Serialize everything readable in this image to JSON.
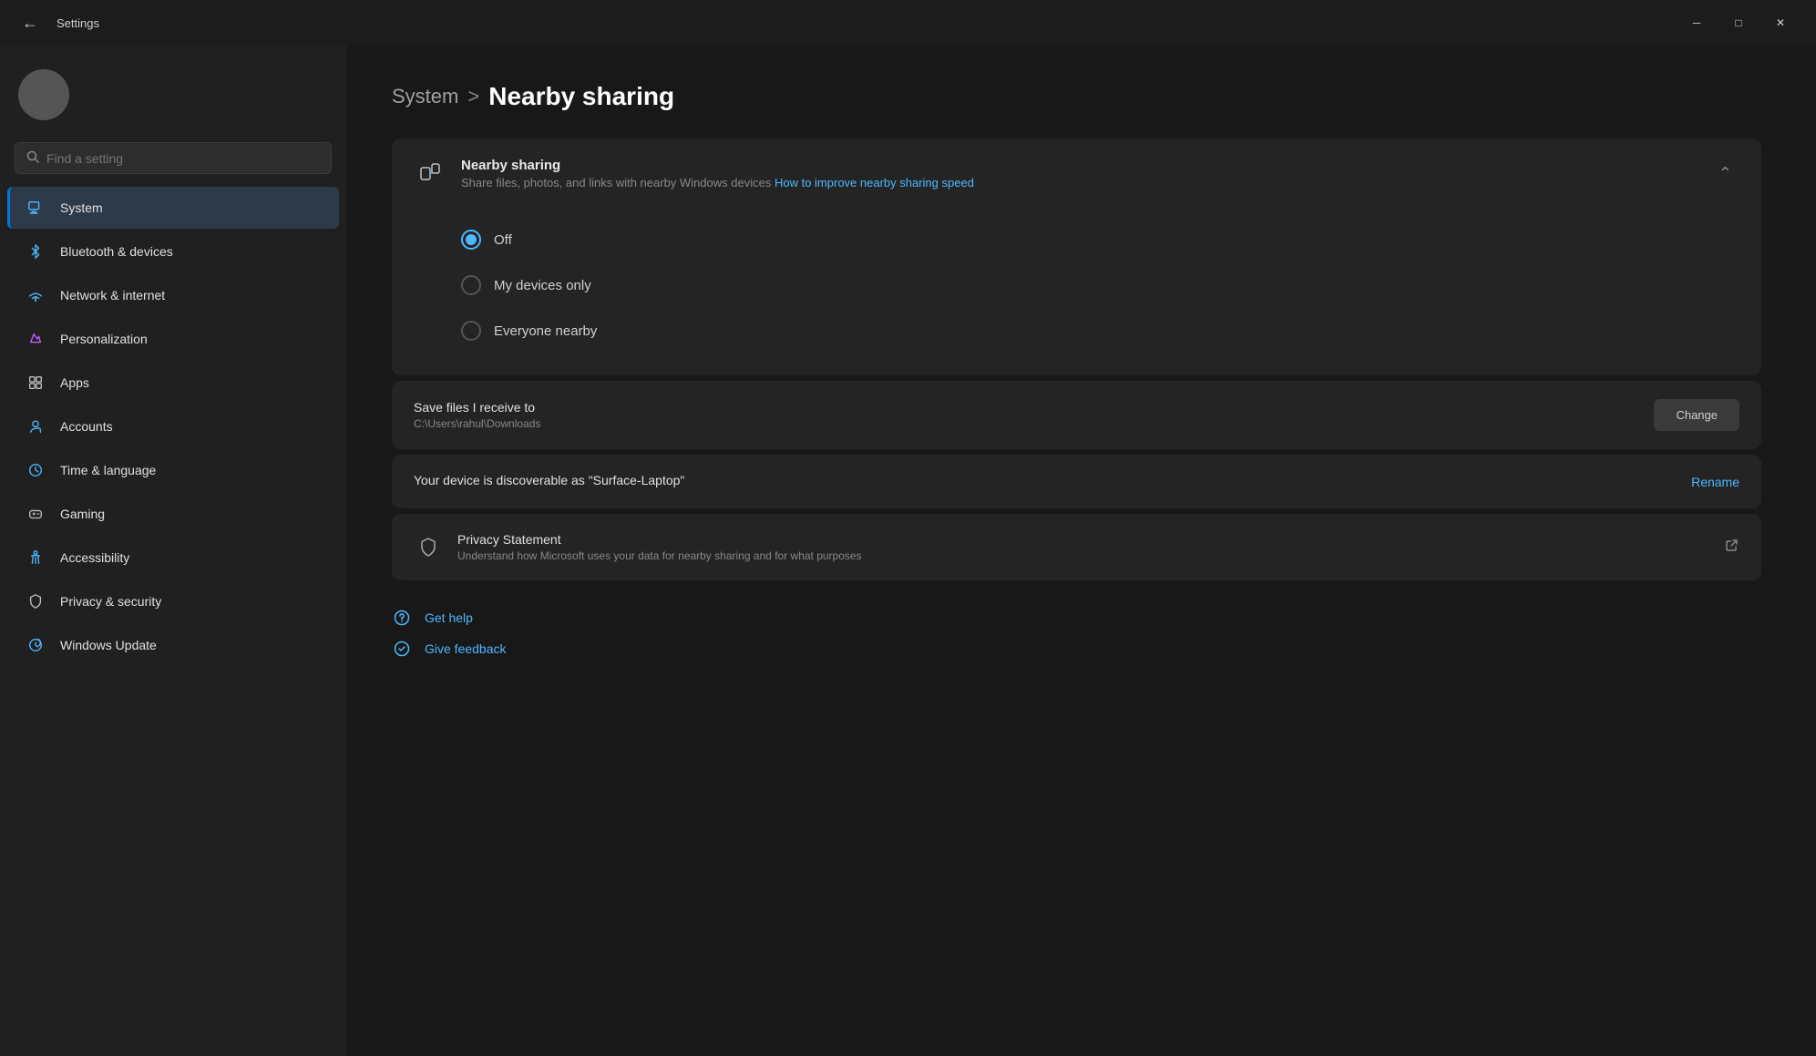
{
  "titlebar": {
    "title": "Settings",
    "minimize_label": "─",
    "maximize_label": "□",
    "close_label": "✕"
  },
  "sidebar": {
    "search_placeholder": "Find a setting",
    "profile_name": "",
    "nav_items": [
      {
        "id": "system",
        "label": "System",
        "active": true
      },
      {
        "id": "bluetooth",
        "label": "Bluetooth & devices",
        "active": false
      },
      {
        "id": "network",
        "label": "Network & internet",
        "active": false
      },
      {
        "id": "personalization",
        "label": "Personalization",
        "active": false
      },
      {
        "id": "apps",
        "label": "Apps",
        "active": false
      },
      {
        "id": "accounts",
        "label": "Accounts",
        "active": false
      },
      {
        "id": "time",
        "label": "Time & language",
        "active": false
      },
      {
        "id": "gaming",
        "label": "Gaming",
        "active": false
      },
      {
        "id": "accessibility",
        "label": "Accessibility",
        "active": false
      },
      {
        "id": "privacy",
        "label": "Privacy & security",
        "active": false
      },
      {
        "id": "windows-update",
        "label": "Windows Update",
        "active": false
      }
    ]
  },
  "main": {
    "breadcrumb_parent": "System",
    "breadcrumb_sep": ">",
    "breadcrumb_current": "Nearby sharing",
    "nearby_sharing_card": {
      "title": "Nearby sharing",
      "subtitle": "Share files, photos, and links with nearby Windows devices",
      "link_text": "How to improve nearby sharing speed",
      "options": [
        {
          "id": "off",
          "label": "Off",
          "selected": true
        },
        {
          "id": "my-devices",
          "label": "My devices only",
          "selected": false
        },
        {
          "id": "everyone",
          "label": "Everyone nearby",
          "selected": false
        }
      ]
    },
    "save_files_card": {
      "title": "Save files I receive to",
      "path": "C:\\Users\\rahul\\Downloads",
      "change_label": "Change"
    },
    "discoverable_card": {
      "text": "Your device is discoverable as \"Surface-Laptop\"",
      "rename_label": "Rename"
    },
    "privacy_card": {
      "title": "Privacy Statement",
      "desc": "Understand how Microsoft uses your data for nearby sharing and for what purposes"
    },
    "footer": {
      "get_help_label": "Get help",
      "give_feedback_label": "Give feedback"
    }
  }
}
